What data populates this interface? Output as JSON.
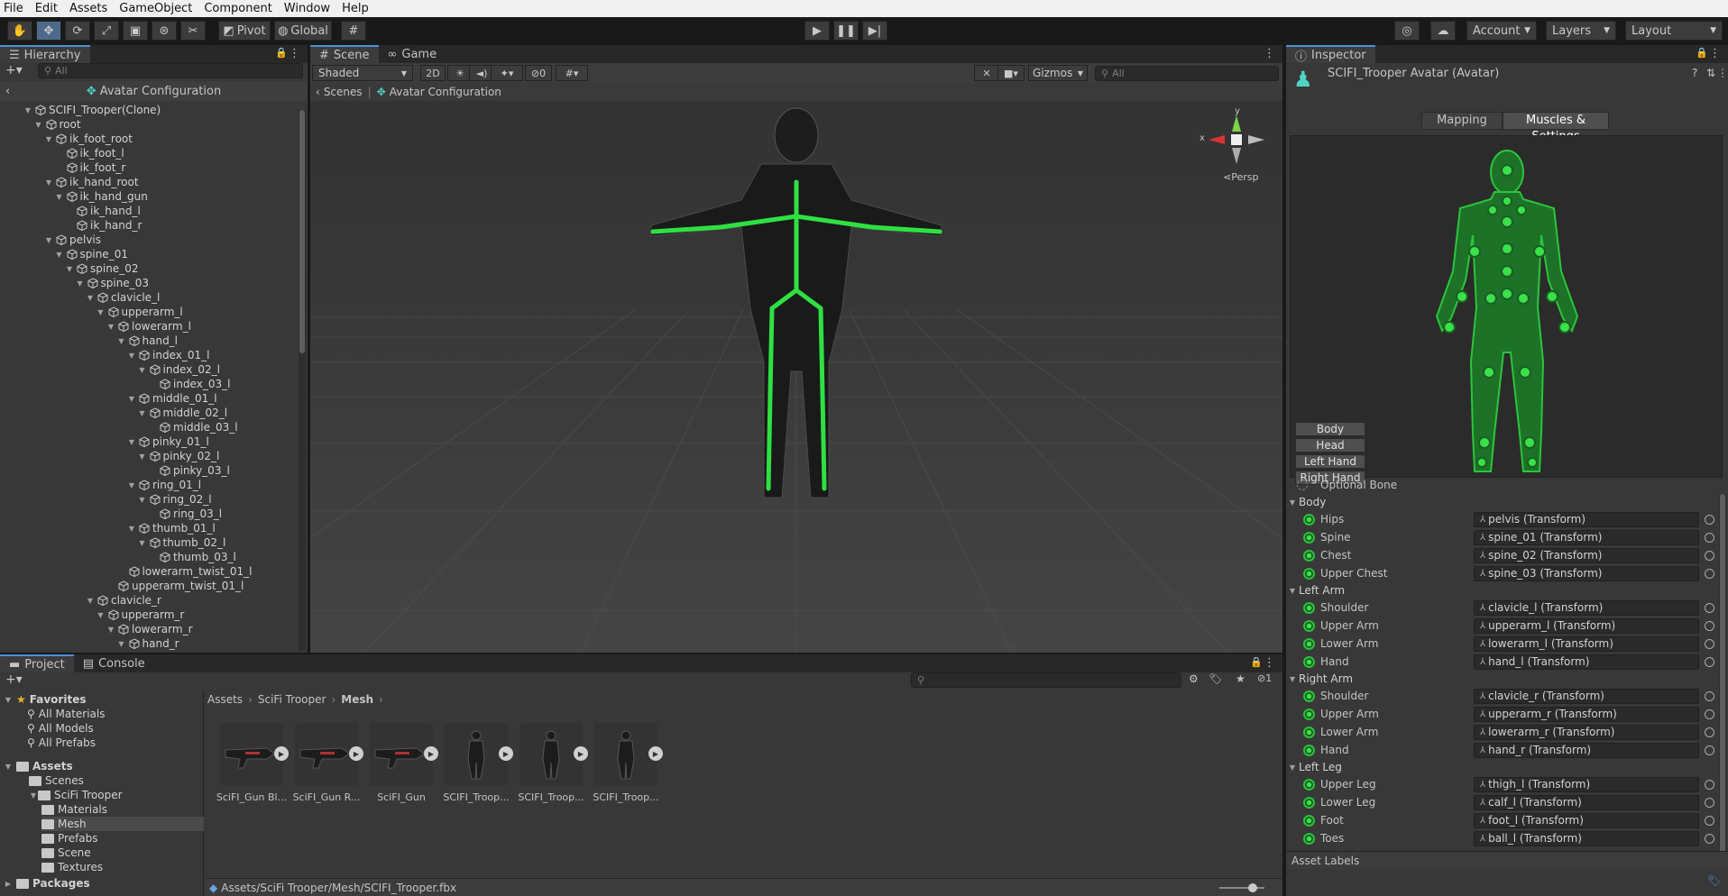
{
  "menubar": [
    "File",
    "Edit",
    "Assets",
    "GameObject",
    "Component",
    "Window",
    "Help"
  ],
  "toolbar": {
    "pivot": "Pivot",
    "global": "Global",
    "account": "Account",
    "layers": "Layers",
    "layout": "Layout"
  },
  "hierarchy": {
    "tab": "Hierarchy",
    "search": "All",
    "header": "Avatar Configuration",
    "items": [
      {
        "label": "SCIFI_Trooper(Clone)",
        "depth": 0,
        "arrow": true
      },
      {
        "label": "root",
        "depth": 1,
        "arrow": true
      },
      {
        "label": "ik_foot_root",
        "depth": 2,
        "arrow": true
      },
      {
        "label": "ik_foot_l",
        "depth": 3,
        "arrow": false
      },
      {
        "label": "ik_foot_r",
        "depth": 3,
        "arrow": false
      },
      {
        "label": "ik_hand_root",
        "depth": 2,
        "arrow": true
      },
      {
        "label": "ik_hand_gun",
        "depth": 3,
        "arrow": true
      },
      {
        "label": "ik_hand_l",
        "depth": 4,
        "arrow": false
      },
      {
        "label": "ik_hand_r",
        "depth": 4,
        "arrow": false
      },
      {
        "label": "pelvis",
        "depth": 2,
        "arrow": true
      },
      {
        "label": "spine_01",
        "depth": 3,
        "arrow": true
      },
      {
        "label": "spine_02",
        "depth": 4,
        "arrow": true
      },
      {
        "label": "spine_03",
        "depth": 5,
        "arrow": true
      },
      {
        "label": "clavicle_l",
        "depth": 6,
        "arrow": true
      },
      {
        "label": "upperarm_l",
        "depth": 7,
        "arrow": true
      },
      {
        "label": "lowerarm_l",
        "depth": 8,
        "arrow": true
      },
      {
        "label": "hand_l",
        "depth": 9,
        "arrow": true
      },
      {
        "label": "index_01_l",
        "depth": 10,
        "arrow": true
      },
      {
        "label": "index_02_l",
        "depth": 11,
        "arrow": true
      },
      {
        "label": "index_03_l",
        "depth": 12,
        "arrow": false
      },
      {
        "label": "middle_01_l",
        "depth": 10,
        "arrow": true
      },
      {
        "label": "middle_02_l",
        "depth": 11,
        "arrow": true
      },
      {
        "label": "middle_03_l",
        "depth": 12,
        "arrow": false
      },
      {
        "label": "pinky_01_l",
        "depth": 10,
        "arrow": true
      },
      {
        "label": "pinky_02_l",
        "depth": 11,
        "arrow": true
      },
      {
        "label": "pinky_03_l",
        "depth": 12,
        "arrow": false
      },
      {
        "label": "ring_01_l",
        "depth": 10,
        "arrow": true
      },
      {
        "label": "ring_02_l",
        "depth": 11,
        "arrow": true
      },
      {
        "label": "ring_03_l",
        "depth": 12,
        "arrow": false
      },
      {
        "label": "thumb_01_l",
        "depth": 10,
        "arrow": true
      },
      {
        "label": "thumb_02_l",
        "depth": 11,
        "arrow": true
      },
      {
        "label": "thumb_03_l",
        "depth": 12,
        "arrow": false
      },
      {
        "label": "lowerarm_twist_01_l",
        "depth": 9,
        "arrow": false
      },
      {
        "label": "upperarm_twist_01_l",
        "depth": 8,
        "arrow": false
      },
      {
        "label": "clavicle_r",
        "depth": 6,
        "arrow": true
      },
      {
        "label": "upperarm_r",
        "depth": 7,
        "arrow": true
      },
      {
        "label": "lowerarm_r",
        "depth": 8,
        "arrow": true
      },
      {
        "label": "hand_r",
        "depth": 9,
        "arrow": true
      }
    ]
  },
  "scene": {
    "tabs": [
      "Scene",
      "Game"
    ],
    "shading": "Shaded",
    "mode2d": "2D",
    "hidden_count": "0",
    "gizmos": "Gizmos",
    "search": "All",
    "breadcrumb": [
      "Scenes",
      "Avatar Configuration"
    ],
    "persp": "Persp",
    "axis_x": "x",
    "axis_y": "y"
  },
  "inspector": {
    "tab": "Inspector",
    "title": "SCIFI_Trooper Avatar (Avatar)",
    "tabs": [
      "Mapping",
      "Muscles & Settings"
    ],
    "parts": [
      "Body",
      "Head",
      "Left Hand",
      "Right Hand"
    ],
    "optional": "Optional Bone",
    "groups": [
      {
        "name": "Body",
        "bones": [
          [
            "Hips",
            "pelvis (Transform)"
          ],
          [
            "Spine",
            "spine_01 (Transform)"
          ],
          [
            "Chest",
            "spine_02 (Transform)"
          ],
          [
            "Upper Chest",
            "spine_03 (Transform)"
          ]
        ]
      },
      {
        "name": "Left Arm",
        "bones": [
          [
            "Shoulder",
            "clavicle_l (Transform)"
          ],
          [
            "Upper Arm",
            "upperarm_l (Transform)"
          ],
          [
            "Lower Arm",
            "lowerarm_l (Transform)"
          ],
          [
            "Hand",
            "hand_l (Transform)"
          ]
        ]
      },
      {
        "name": "Right Arm",
        "bones": [
          [
            "Shoulder",
            "clavicle_r (Transform)"
          ],
          [
            "Upper Arm",
            "upperarm_r (Transform)"
          ],
          [
            "Lower Arm",
            "lowerarm_r (Transform)"
          ],
          [
            "Hand",
            "hand_r (Transform)"
          ]
        ]
      },
      {
        "name": "Left Leg",
        "bones": [
          [
            "Upper Leg",
            "thigh_l (Transform)"
          ],
          [
            "Lower Leg",
            "calf_l (Transform)"
          ],
          [
            "Foot",
            "foot_l (Transform)"
          ],
          [
            "Toes",
            "ball_l (Transform)"
          ]
        ]
      }
    ],
    "asset_labels": "Asset Labels"
  },
  "project": {
    "tabs": [
      "Project",
      "Console"
    ],
    "hidden_count": "1",
    "favorites": {
      "label": "Favorites",
      "items": [
        "All Materials",
        "All Models",
        "All Prefabs"
      ]
    },
    "assets_label": "Assets",
    "tree": [
      {
        "label": "Scenes",
        "depth": 1
      },
      {
        "label": "SciFi Trooper",
        "depth": 1
      },
      {
        "label": "Materials",
        "depth": 2
      },
      {
        "label": "Mesh",
        "depth": 2
      },
      {
        "label": "Prefabs",
        "depth": 2
      },
      {
        "label": "Scene",
        "depth": 2
      },
      {
        "label": "Textures",
        "depth": 2
      }
    ],
    "packages": "Packages",
    "breadcrumb": [
      "Assets",
      "SciFi Trooper",
      "Mesh"
    ],
    "assets": [
      "SciFI_Gun Bl...",
      "SciFI_Gun R...",
      "SciFI_Gun",
      "SCIFI_Troop...",
      "SCIFI_Troop...",
      "SCIFI_Troop..."
    ],
    "status_path": "Assets/SciFi Trooper/Mesh/SCIFI_Trooper.fbx"
  },
  "colors": {
    "accent": "#4a90d8",
    "bone_green": "#2bbf3c"
  }
}
